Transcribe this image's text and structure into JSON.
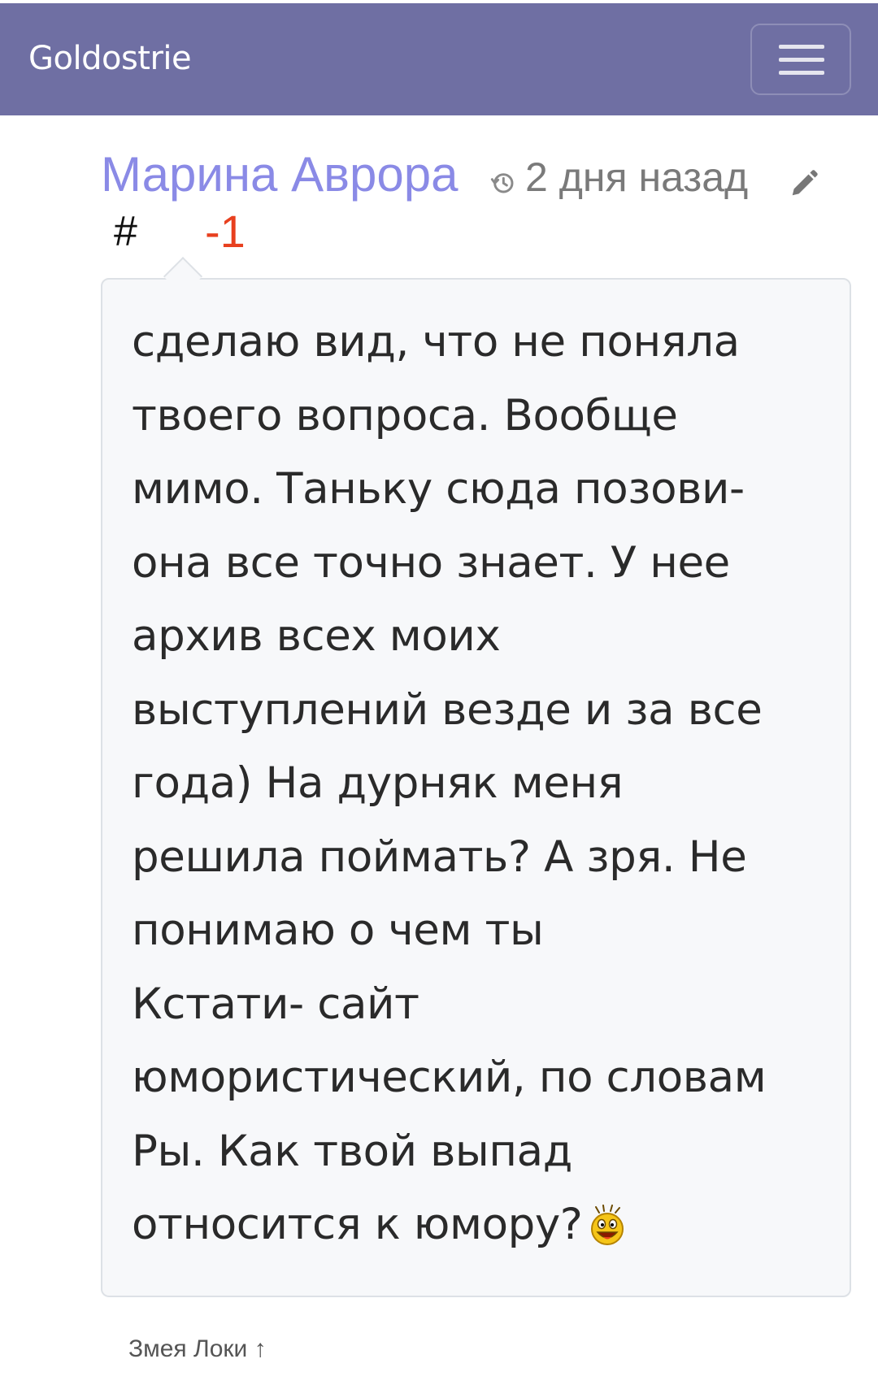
{
  "navbar": {
    "brand": "Goldostrie",
    "menu_icon": "hamburger-menu-icon",
    "background_color": "#6f6fa3"
  },
  "comment": {
    "author": "Марина Аврора",
    "author_color": "#8a8ae6",
    "time_icon": "history-clock-icon",
    "time": "2 дня назад",
    "edit_icon": "pencil-icon",
    "permalink": "#",
    "rating": "-1",
    "rating_color": "#e8401f",
    "body_lines": [
      "сделаю вид, что не поняла",
      "твоего вопроса. Вообще",
      "мимо. Таньку сюда позови-",
      "она все точно знает. У нее",
      "архив всех моих",
      "выступлений везде и за все",
      "года) На дурняк меня",
      "решила поймать? А зря. Не",
      "понимаю о чем ты",
      "Кстати- сайт",
      "юмористический, по словам",
      "Ры. Как твой выпад",
      "относится к юмору?"
    ],
    "emoji": "laughing-smiley-icon"
  },
  "reply": {
    "label": "Змея Локи ↑"
  }
}
